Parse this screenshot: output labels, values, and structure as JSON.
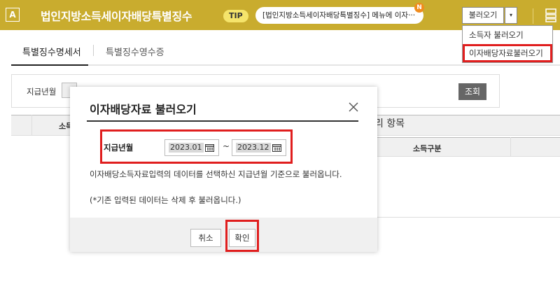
{
  "header": {
    "logo": "A",
    "title": "법인지방소득세이자배당특별징수",
    "tip_label": "TIP",
    "tip_text": "[법인지방소득세이자배당특별징수] 메뉴에 이자···",
    "new_badge": "N",
    "load_button": "불러오기",
    "load_arrow": "▾"
  },
  "dropdown": {
    "items": [
      "소득자 불러오기",
      "이자배당자료불러오기"
    ]
  },
  "tabs": [
    "특별징수명세서",
    "특별징수영수증"
  ],
  "search": {
    "label": "지급년월",
    "button": "조회"
  },
  "grid": {
    "header_partial": "소득",
    "side_text": "리 항목",
    "column": "소득구분"
  },
  "modal": {
    "title": "이자배당자료 불러오기",
    "date_label": "지급년월",
    "date_from": "2023.01",
    "date_to": "2023.12",
    "tilde": "~",
    "description": "이자배당소득자료입력의 데이터를 선택하신 지급년월 기준으로 불러옵니다.",
    "note": "(*기존 입력된 데이터는 삭제 후 불러옵니다.)",
    "cancel": "취소",
    "confirm": "확인"
  },
  "colors": {
    "header_bg": "#c9ac2e",
    "highlight": "#e01e1e",
    "tip_badge": "#f5e46b",
    "new_badge": "#f08c1e"
  }
}
